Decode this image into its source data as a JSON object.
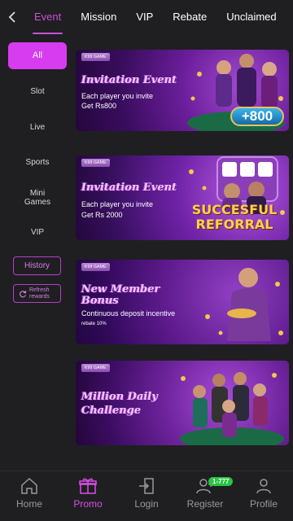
{
  "topbar": {
    "back_icon": "chevron-left-icon",
    "tabs": [
      {
        "label": "Event",
        "active": true
      },
      {
        "label": "Mission"
      },
      {
        "label": "VIP"
      },
      {
        "label": "Rebate"
      },
      {
        "label": "Unclaimed"
      }
    ]
  },
  "sidebar": {
    "categories": [
      "All",
      "Slot",
      "Live",
      "Sports",
      "Mini Games",
      "VIP"
    ],
    "history_label": "History",
    "refresh_label": "Refresh rewards",
    "refresh_icon": "refresh-icon"
  },
  "banners": [
    {
      "tag": "K99 GAME",
      "title": "Invitation Event",
      "line1": "Each player you invite",
      "line2": "Get Rs800",
      "badge": "+800"
    },
    {
      "tag": "K99 GAME",
      "title": "Invitation Event",
      "line1": "Each player you invite",
      "line2": "Get Rs 2000",
      "art_line1": "SUCCESFUL",
      "art_line2": "REFORRAL"
    },
    {
      "tag": "K99 GAME",
      "title_line1": "New Member",
      "title_line2": "Bonus",
      "line1": "Continuous deposit incentive",
      "small": "rebate 10%"
    },
    {
      "tag": "K99 GAME",
      "title_line1": "Million Daily",
      "title_line2": "Challenge"
    }
  ],
  "bottom_nav": [
    {
      "label": "Home",
      "icon": "home-icon"
    },
    {
      "label": "Promo",
      "icon": "gift-icon",
      "active": true
    },
    {
      "label": "Login",
      "icon": "login-icon"
    },
    {
      "label": "Register",
      "icon": "add-user-icon",
      "badge": "1-777"
    },
    {
      "label": "Profile",
      "icon": "user-icon"
    }
  ],
  "colors": {
    "accent": "#d83cf0",
    "background": "#1f1f21",
    "badge_green": "#27c540"
  }
}
